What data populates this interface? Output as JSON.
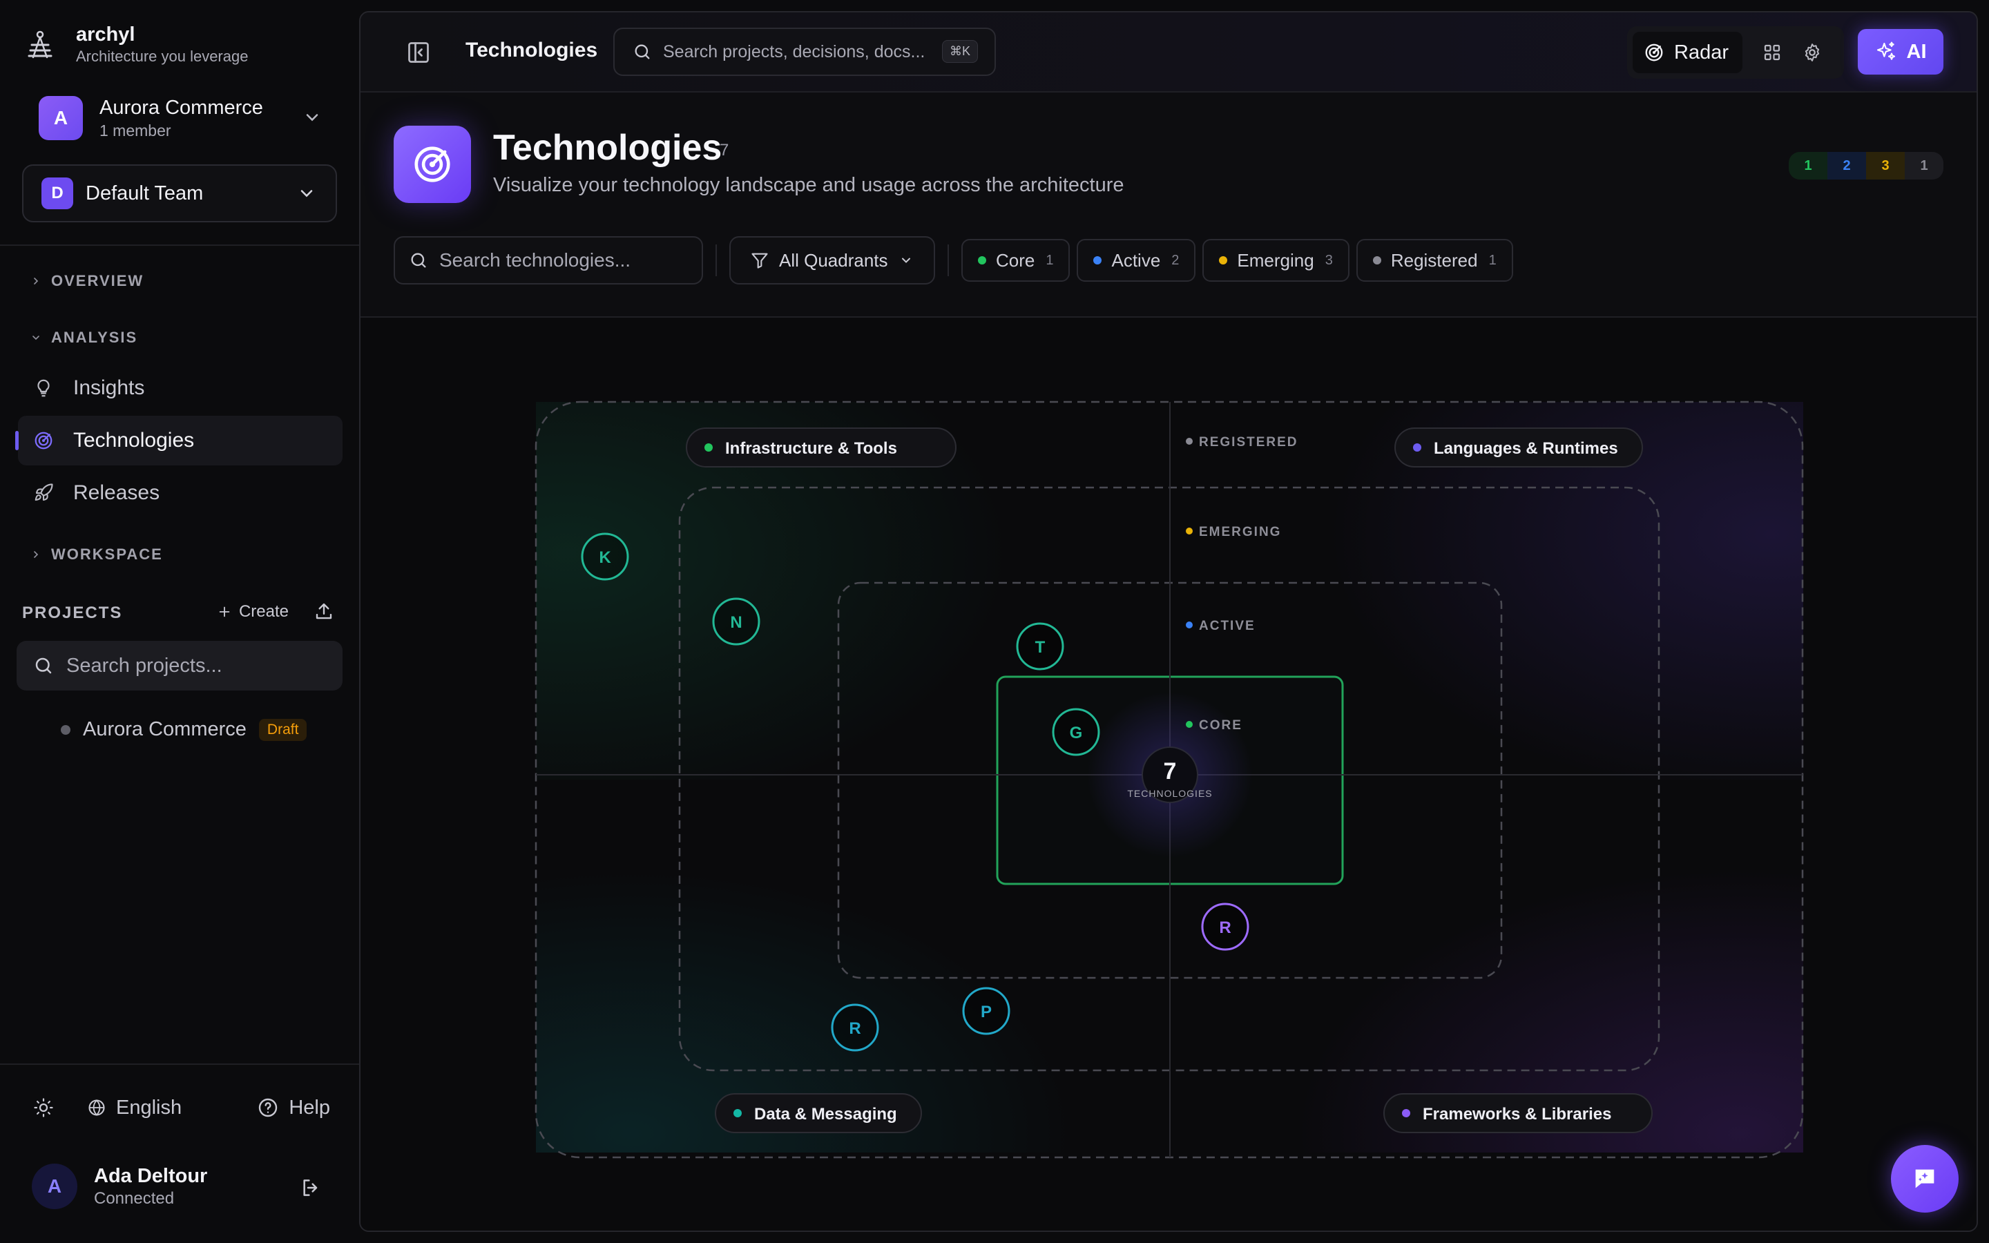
{
  "brand": {
    "name": "archyl",
    "tagline": "Architecture you leverage"
  },
  "org": {
    "initial": "A",
    "name": "Aurora Commerce",
    "members": "1 member"
  },
  "team": {
    "initial": "D",
    "name": "Default Team"
  },
  "nav": {
    "overview": "OVERVIEW",
    "analysis": "ANALYSIS",
    "items": [
      {
        "label": "Insights",
        "icon": "lightbulb-icon"
      },
      {
        "label": "Technologies",
        "icon": "radar-icon",
        "active": true
      },
      {
        "label": "Releases",
        "icon": "rocket-icon"
      }
    ],
    "workspace": "WORKSPACE"
  },
  "projects": {
    "title": "PROJECTS",
    "create_label": "Create",
    "search_placeholder": "Search projects...",
    "items": [
      {
        "name": "Aurora Commerce",
        "badge": "Draft"
      }
    ]
  },
  "footer": {
    "language": "English",
    "help": "Help"
  },
  "user": {
    "initial": "A",
    "name": "Ada Deltour",
    "status": "Connected"
  },
  "topbar": {
    "title": "Technologies",
    "search_placeholder": "Search projects, decisions, docs...",
    "shortcut": "⌘K",
    "view_label": "Radar",
    "ai_label": "AI"
  },
  "page": {
    "title": "Technologies",
    "count": "7",
    "subtitle": "Visualize your technology landscape and usage across the architecture",
    "legend_counts": [
      {
        "value": "1",
        "color": "#22c55e",
        "bg": "#0f2417"
      },
      {
        "value": "2",
        "color": "#3b82f6",
        "bg": "#101b33"
      },
      {
        "value": "3",
        "color": "#eab308",
        "bg": "#2b230a"
      },
      {
        "value": "1",
        "color": "#8a8a94",
        "bg": "#1c1c21"
      }
    ]
  },
  "filters": {
    "search_placeholder": "Search technologies...",
    "quadrant_label": "All Quadrants",
    "rings": [
      {
        "label": "Core",
        "count": "1",
        "color": "#22c55e"
      },
      {
        "label": "Active",
        "count": "2",
        "color": "#3b82f6"
      },
      {
        "label": "Emerging",
        "count": "3",
        "color": "#eab308"
      },
      {
        "label": "Registered",
        "count": "1",
        "color": "#8a8a94"
      }
    ]
  },
  "radar": {
    "total": "7",
    "total_label": "TECHNOLOGIES",
    "ring_labels": [
      {
        "label": "REGISTERED",
        "color": "#8a8a94"
      },
      {
        "label": "EMERGING",
        "color": "#eab308"
      },
      {
        "label": "ACTIVE",
        "color": "#3b82f6"
      },
      {
        "label": "CORE",
        "color": "#22c55e"
      }
    ],
    "quadrants": [
      {
        "label": "Infrastructure & Tools",
        "color": "#22c55e"
      },
      {
        "label": "Languages & Runtimes",
        "color": "#6d5cf0"
      },
      {
        "label": "Data & Messaging",
        "color": "#14b8a6"
      },
      {
        "label": "Frameworks & Libraries",
        "color": "#8b5cf6"
      }
    ],
    "blips": [
      {
        "letter": "K",
        "quadrant": "Infrastructure & Tools",
        "ring": "Registered",
        "color": "#22b895"
      },
      {
        "letter": "N",
        "quadrant": "Infrastructure & Tools",
        "ring": "Emerging",
        "color": "#22b895"
      },
      {
        "letter": "T",
        "quadrant": "Infrastructure & Tools",
        "ring": "Emerging",
        "color": "#22b895"
      },
      {
        "letter": "G",
        "quadrant": "Infrastructure & Tools",
        "ring": "Active",
        "color": "#22b895"
      },
      {
        "letter": "R",
        "quadrant": "Frameworks & Libraries",
        "ring": "Active",
        "color": "#9d6bff"
      },
      {
        "letter": "R",
        "quadrant": "Data & Messaging",
        "ring": "Emerging",
        "color": "#22a8c9"
      },
      {
        "letter": "P",
        "quadrant": "Data & Messaging",
        "ring": "Emerging",
        "color": "#22a8c9"
      }
    ]
  }
}
